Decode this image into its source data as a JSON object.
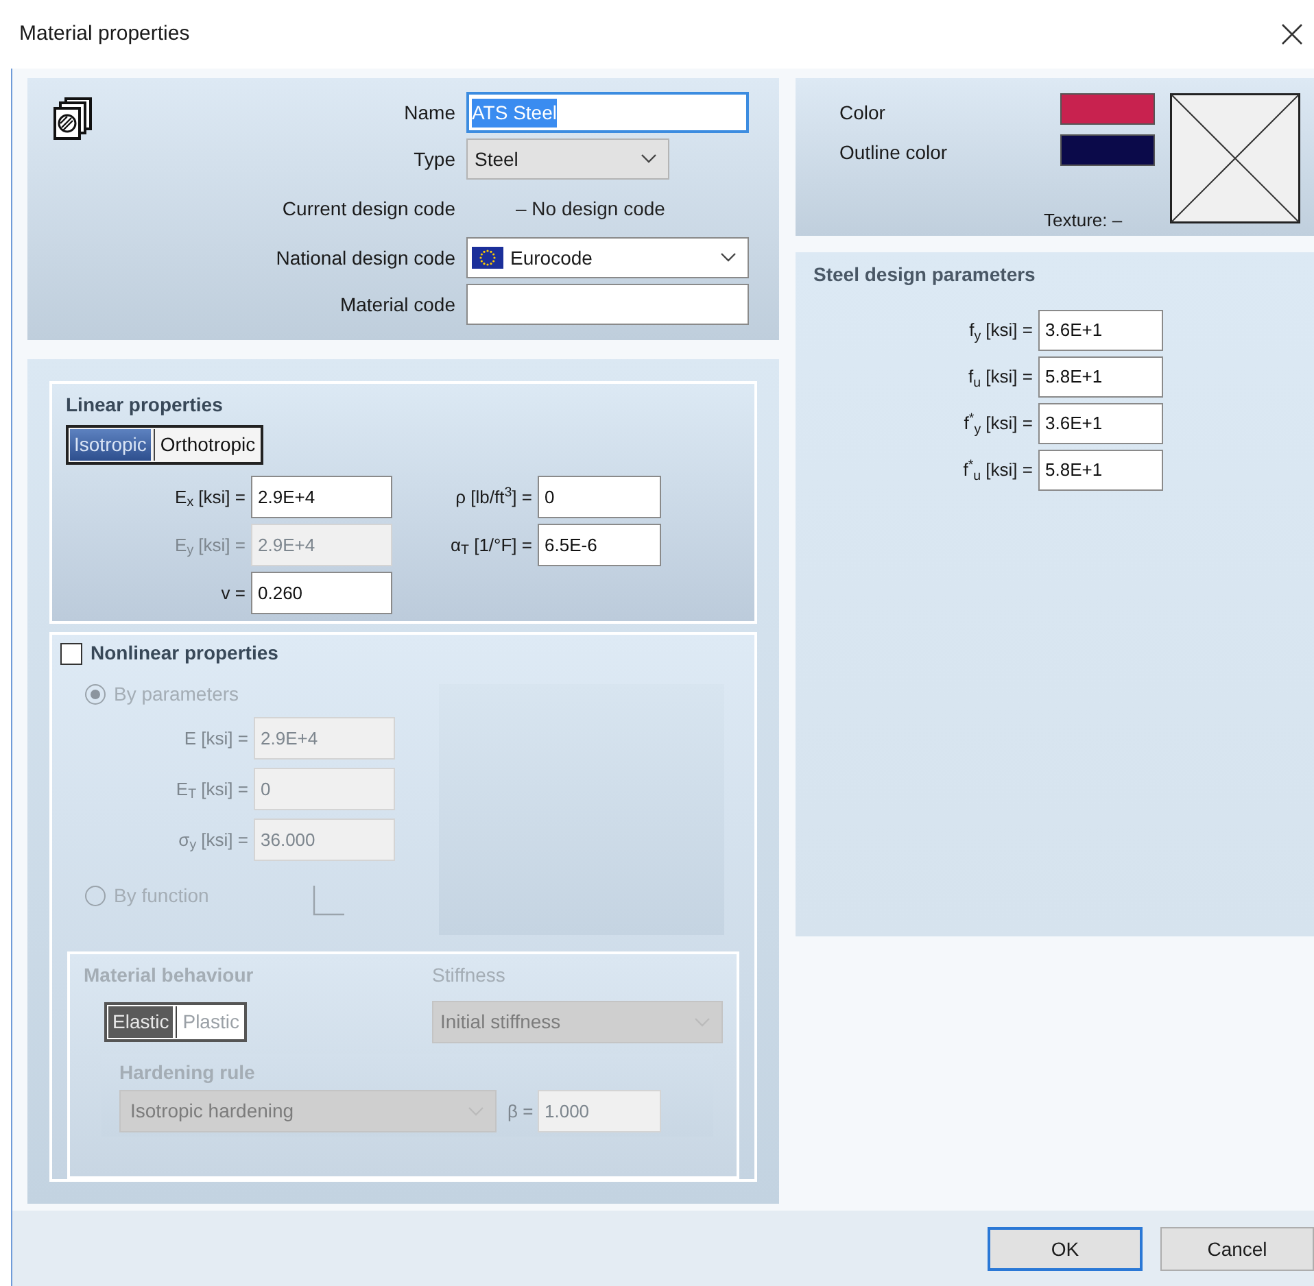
{
  "window": {
    "title": "Material properties"
  },
  "general": {
    "fields": [
      {
        "kind": "text",
        "label": "Name",
        "value": "ATS Steel",
        "text_selected": true
      },
      {
        "kind": "select",
        "label": "Type",
        "value": "Steel"
      },
      {
        "kind": "static",
        "label": "Current design code",
        "value": "– No design code"
      },
      {
        "kind": "flag_select",
        "label": "National design code",
        "value": "Eurocode"
      },
      {
        "kind": "text",
        "label": "Material code",
        "text_selected": false
      }
    ]
  },
  "appearance": {
    "swatches": [
      {
        "label": "Color",
        "color": "#c8224f"
      },
      {
        "label": "Outline color",
        "color": "#0b0a4a"
      }
    ],
    "texture_label": "Texture: –"
  },
  "linear": {
    "title": "Linear properties",
    "modes": [
      {
        "label": "Isotropic",
        "selected": true
      },
      {
        "label": "Orthotropic",
        "selected": false
      }
    ],
    "left_fields": [
      {
        "label": "E$_{x}$ [ksi] =",
        "value": "2.9E+4",
        "disabled": false
      },
      {
        "label": "E$_{y}$ [ksi] =",
        "value": "2.9E+4",
        "disabled": true
      },
      {
        "label": "v =",
        "value": "0.260",
        "disabled": false
      }
    ],
    "right_fields": [
      {
        "label": "ρ [lb/ft$^{3}$] =",
        "value": "0",
        "disabled": false
      },
      {
        "label": "α$_{T}$ [1/°F] =",
        "value": "6.5E-6",
        "disabled": false
      }
    ]
  },
  "nonlinear": {
    "title": "Nonlinear properties",
    "checked": false,
    "methods": [
      {
        "label": "By parameters",
        "selected": true
      },
      {
        "label": "By function",
        "selected": false
      }
    ],
    "fields": [
      {
        "label": "E [ksi] =",
        "value": "2.9E+4"
      },
      {
        "label": "E$_{T}$ [ksi] =",
        "value": "0"
      },
      {
        "label": "σ$_{y}$ [ksi] =",
        "value": "36.000"
      }
    ],
    "behaviour": {
      "title": "Material behaviour",
      "modes": [
        {
          "label": "Elastic",
          "selected": true
        },
        {
          "label": "Plastic",
          "selected": false
        }
      ],
      "stiffness_title": "Stiffness",
      "stiffness": "Initial stiffness",
      "hardening_title": "Hardening rule",
      "hardening": "Isotropic hardening",
      "beta_label": "β =",
      "beta": "1.000"
    }
  },
  "steel": {
    "title": "Steel design parameters",
    "fields": [
      {
        "label": "f$_{y}$ [ksi] =",
        "value": "3.6E+1"
      },
      {
        "label": "f$_{u}$ [ksi] =",
        "value": "5.8E+1"
      },
      {
        "label": "f$^{*}$$_{y}$ [ksi] =",
        "value": "3.6E+1"
      },
      {
        "label": "f$^{*}$$_{u}$ [ksi] =",
        "value": "5.8E+1"
      }
    ]
  },
  "buttons": [
    {
      "label": "OK",
      "default": true
    },
    {
      "label": "Cancel",
      "default": false
    }
  ]
}
